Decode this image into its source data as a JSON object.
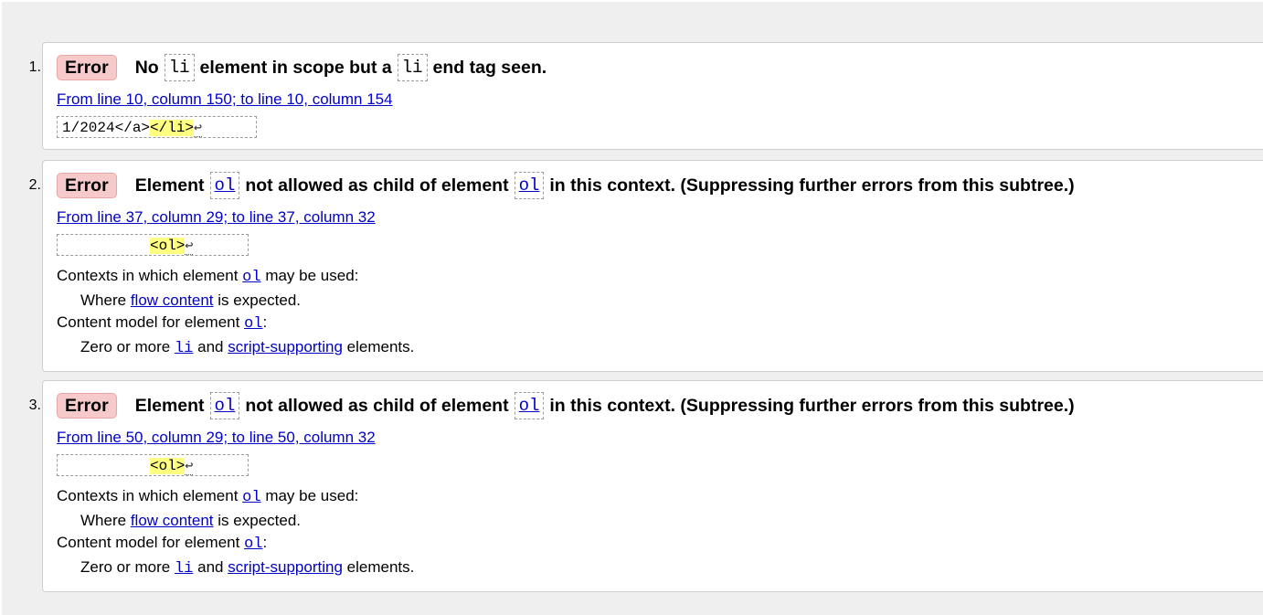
{
  "messages": [
    {
      "number": "1.",
      "type": "Error",
      "parts": [
        "No",
        "li",
        "element in scope but a",
        "li",
        "end tag seen."
      ],
      "location": "From line 10, column 150; to line 10, column 154",
      "extract": {
        "pre": "1/2024</a>",
        "highlight": "</li>",
        "lf": "↩"
      }
    },
    {
      "number": "2.",
      "type": "Error",
      "parts": [
        "Element",
        "ol",
        "not allowed as child of element",
        "ol",
        "in this context. (Suppressing further errors from this subtree.)"
      ],
      "location": "From line 37, column 29; to line 37, column 32",
      "extract": {
        "pre": "",
        "highlight": "<ol>",
        "lf": "↩"
      },
      "contexts_label": [
        "Contexts in which element",
        "ol",
        "may be used:"
      ],
      "contexts_where": [
        "Where",
        "flow content",
        "is expected."
      ],
      "model_label": [
        "Content model for element",
        "ol",
        ":"
      ],
      "model_text": [
        "Zero or more",
        "li",
        "and",
        "script-supporting",
        "elements."
      ]
    },
    {
      "number": "3.",
      "type": "Error",
      "parts": [
        "Element",
        "ol",
        "not allowed as child of element",
        "ol",
        "in this context. (Suppressing further errors from this subtree.)"
      ],
      "location": "From line 50, column 29; to line 50, column 32",
      "extract": {
        "pre": "",
        "highlight": "<ol>",
        "lf": "↩"
      },
      "contexts_label": [
        "Contexts in which element",
        "ol",
        "may be used:"
      ],
      "contexts_where": [
        "Where",
        "flow content",
        "is expected."
      ],
      "model_label": [
        "Content model for element",
        "ol",
        ":"
      ],
      "model_text": [
        "Zero or more",
        "li",
        "and",
        "script-supporting",
        "elements."
      ]
    }
  ],
  "colors": {
    "badge_bg": "#f6caca",
    "link": "#0000c8",
    "highlight": "#ffff80",
    "page_bg": "#efefef"
  }
}
